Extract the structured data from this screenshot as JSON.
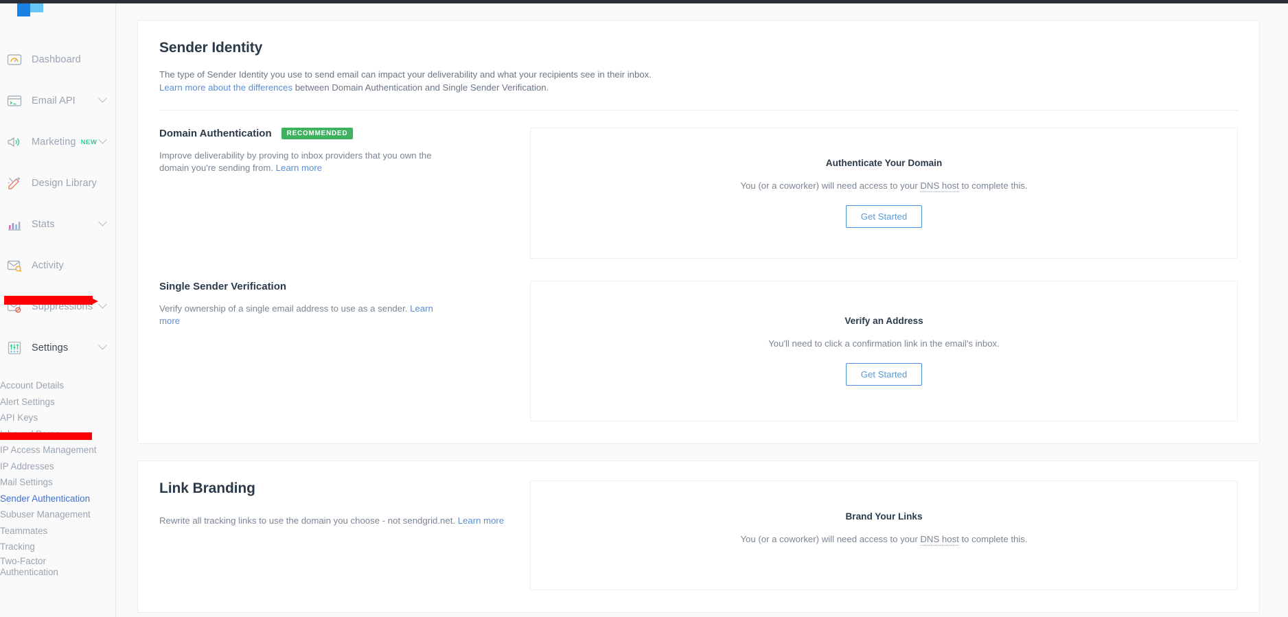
{
  "colors": {
    "accent_blue": "#1a82e2",
    "link_blue": "#5b8fd4",
    "recommended_green": "#3eb35f",
    "annotation_red": "#fb0007",
    "heading": "#2b3a4a",
    "muted_text": "#9aa5b1"
  },
  "sidebar": {
    "items": [
      {
        "label": "Dashboard",
        "icon": "gauge-icon",
        "has_chevron": false,
        "badge": ""
      },
      {
        "label": "Email API",
        "icon": "terminal-icon",
        "has_chevron": true,
        "badge": ""
      },
      {
        "label": "Marketing",
        "icon": "megaphone-icon",
        "has_chevron": true,
        "badge": "NEW"
      },
      {
        "label": "Design Library",
        "icon": "pencil-ruler-icon",
        "has_chevron": false,
        "badge": ""
      },
      {
        "label": "Stats",
        "icon": "bar-chart-icon",
        "has_chevron": true,
        "badge": ""
      },
      {
        "label": "Activity",
        "icon": "envelope-search-icon",
        "has_chevron": false,
        "badge": ""
      },
      {
        "label": "Suppressions",
        "icon": "envelope-blocked-icon",
        "has_chevron": true,
        "badge": ""
      },
      {
        "label": "Settings",
        "icon": "sliders-icon",
        "has_chevron": true,
        "badge": ""
      }
    ],
    "submenu": [
      {
        "label": "Account Details",
        "selected": false
      },
      {
        "label": "Alert Settings",
        "selected": false
      },
      {
        "label": "API Keys",
        "selected": false
      },
      {
        "label": "Inbound Parse",
        "selected": false
      },
      {
        "label": "IP Access Management",
        "selected": false
      },
      {
        "label": "IP Addresses",
        "selected": false
      },
      {
        "label": "Mail Settings",
        "selected": false
      },
      {
        "label": "Sender Authentication",
        "selected": true
      },
      {
        "label": "Subuser Management",
        "selected": false
      },
      {
        "label": "Teammates",
        "selected": false
      },
      {
        "label": "Tracking",
        "selected": false
      },
      {
        "label": "Two-Factor\nAuthentication",
        "selected": false
      }
    ]
  },
  "sender_identity": {
    "title": "Sender Identity",
    "description_line1": "The type of Sender Identity you use to send email can impact your deliverability and what your recipients see in their inbox.",
    "description_link": "Learn more about the differences",
    "description_line2_rest": " between Domain Authentication and Single Sender Verification.",
    "domain_auth": {
      "title": "Domain Authentication",
      "badge": "RECOMMENDED",
      "description": "Improve deliverability by proving to inbox providers that you own the domain you're sending from.",
      "learn_more": "Learn more",
      "card": {
        "title": "Authenticate Your Domain",
        "desc_before": "You (or a coworker) will need access to your ",
        "desc_tooltip": "DNS host",
        "desc_after": " to complete this.",
        "button": "Get Started"
      }
    },
    "single_sender": {
      "title": "Single Sender Verification",
      "description": "Verify ownership of a single email address to use as a sender.",
      "learn_more": "Learn more",
      "card": {
        "title": "Verify an Address",
        "desc": "You'll need to click a confirmation link in the email's inbox.",
        "button": "Get Started"
      }
    }
  },
  "link_branding": {
    "title": "Link Branding",
    "description": "Rewrite all tracking links to use the domain you choose - not sendgrid.net.",
    "learn_more": "Learn more",
    "card": {
      "title": "Brand Your Links",
      "desc_before": "You (or a coworker) will need access to your ",
      "desc_tooltip": "DNS host",
      "desc_after": " to complete this."
    }
  }
}
